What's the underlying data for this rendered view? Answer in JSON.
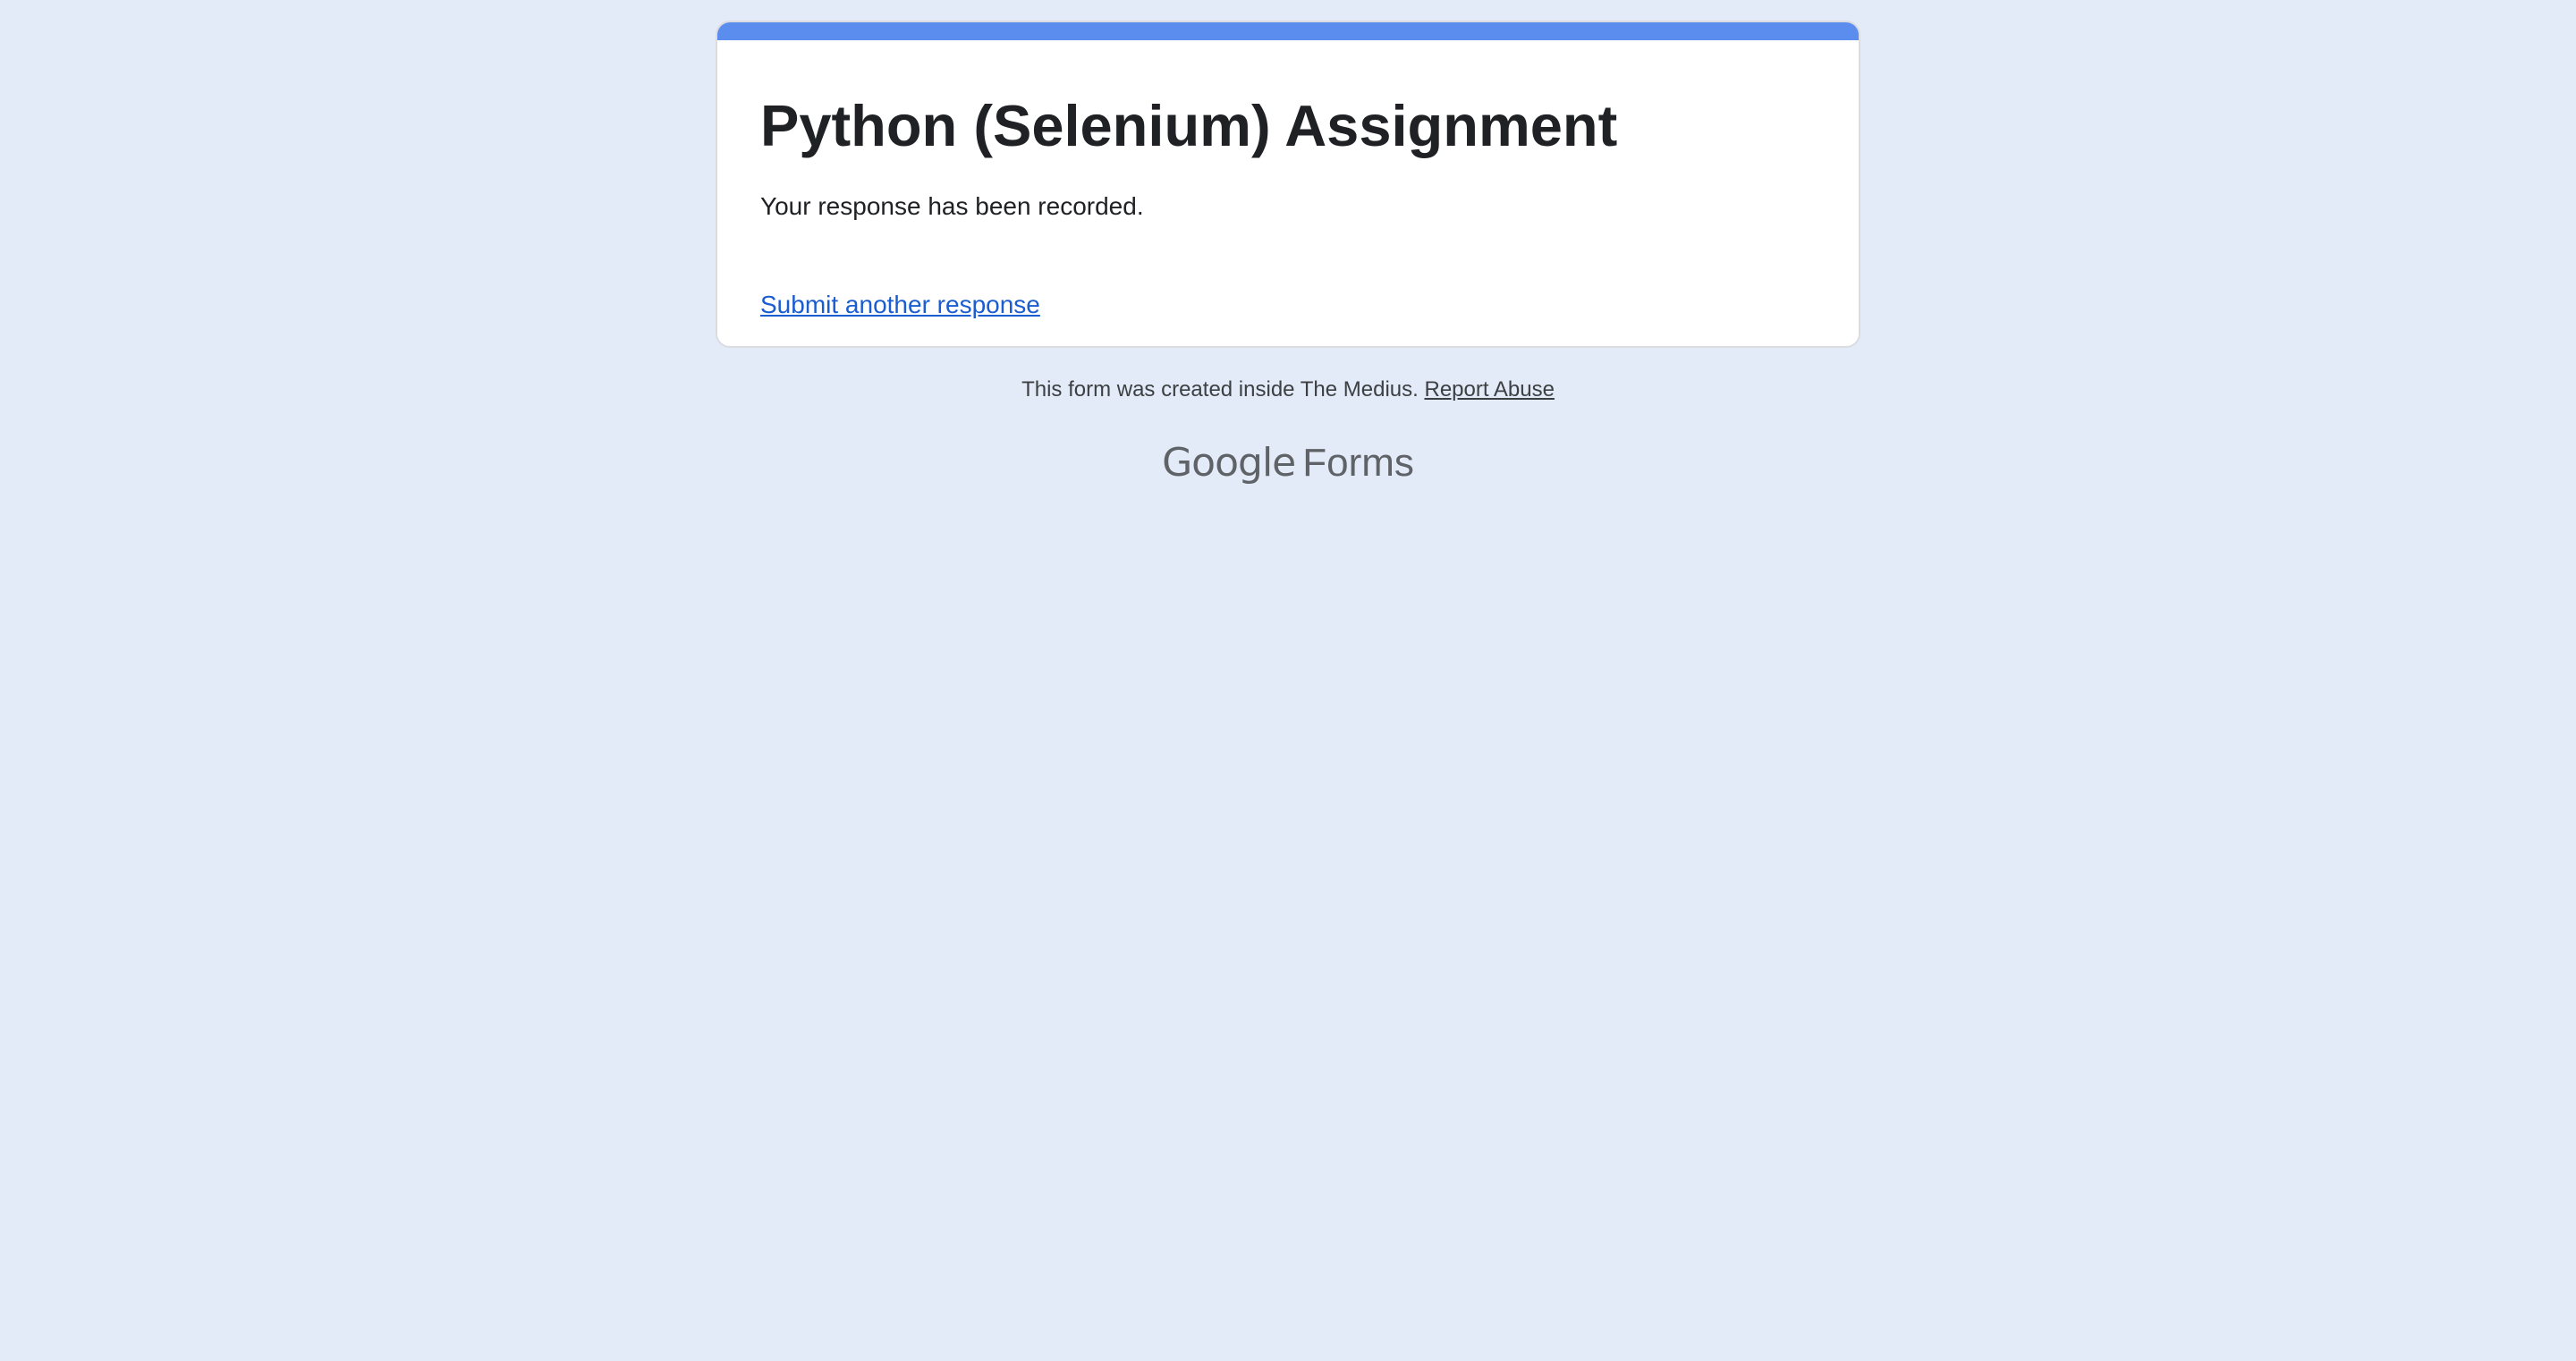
{
  "form": {
    "title": "Python (Selenium) Assignment",
    "confirmation_message": "Your response has been recorded.",
    "submit_another_link": "Submit another response"
  },
  "footer": {
    "notice": "This form was created inside The Medius.",
    "report_link": "Report Abuse"
  },
  "branding": {
    "company": "Google",
    "product": "Forms"
  },
  "colors": {
    "background": "#e4ebf8",
    "accent": "#5b8def",
    "link": "#1a5dd0",
    "title_text": "#202124",
    "brand_gray": "#5f6368"
  }
}
